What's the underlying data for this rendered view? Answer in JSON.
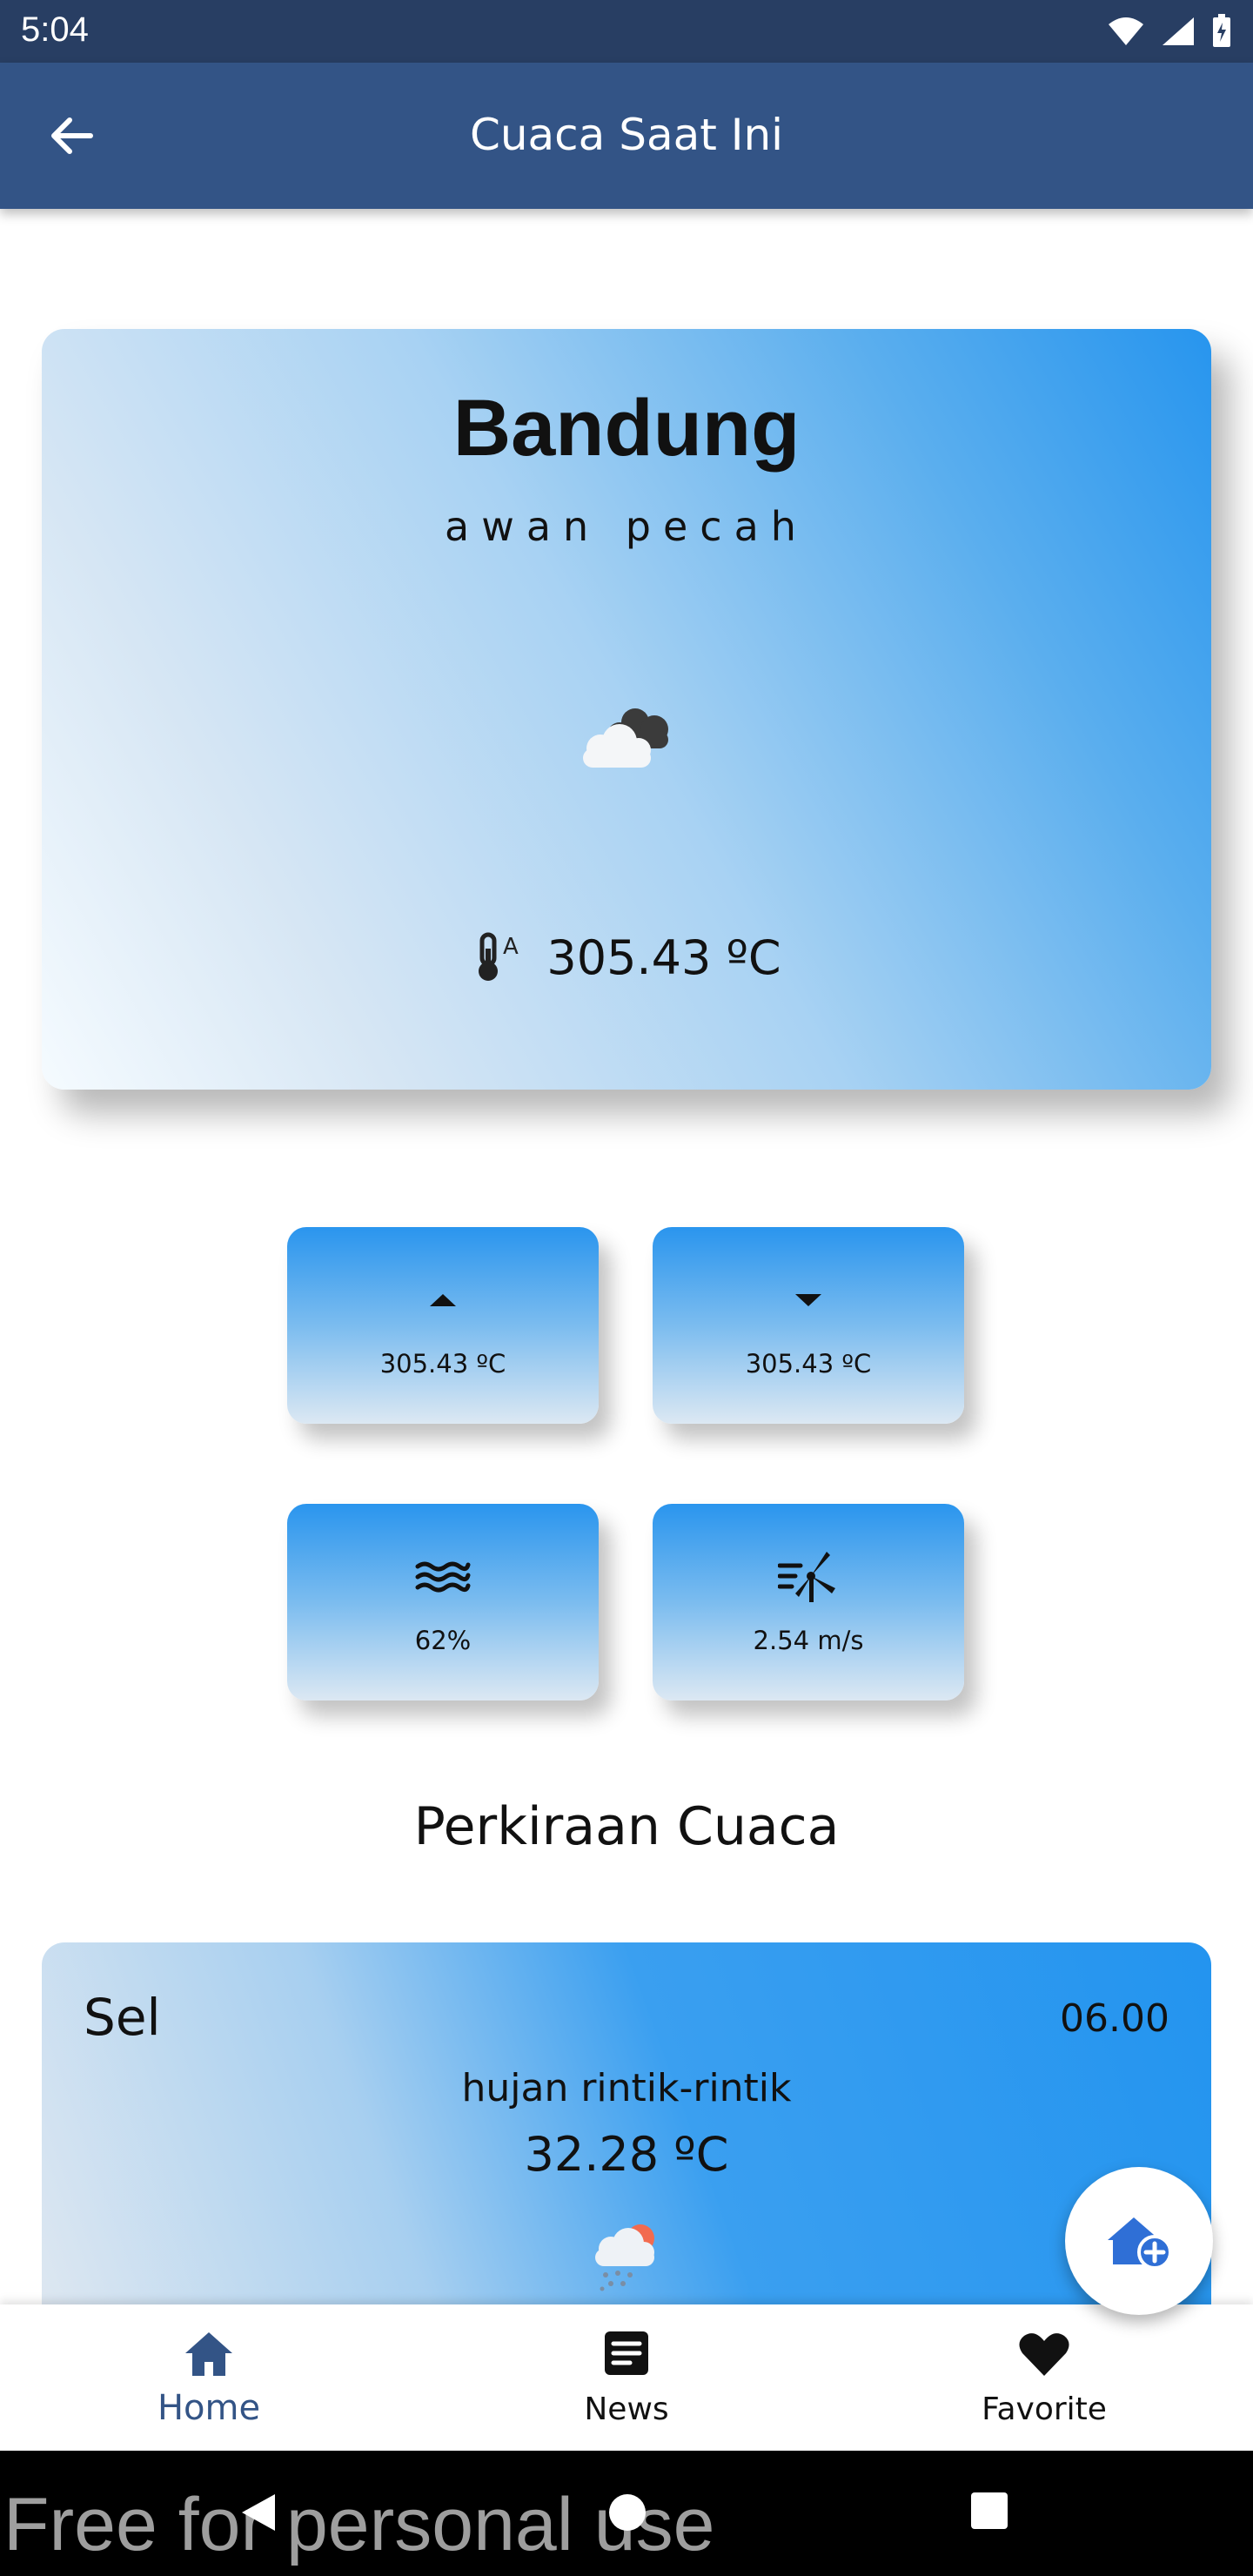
{
  "status_bar": {
    "time": "5:04"
  },
  "app_bar": {
    "title": "Cuaca Saat Ini"
  },
  "current": {
    "city": "Bandung",
    "description": "awan pecah",
    "temperature": "305.43 ºC"
  },
  "stats": {
    "temp_max": "305.43 ºC",
    "temp_min": "305.43 ºC",
    "humidity": "62%",
    "wind_speed": "2.54 m/s"
  },
  "forecast": {
    "section_title": "Perkiraan Cuaca",
    "items": [
      {
        "day": "Sel",
        "time": "06.00",
        "description": "hujan rintik-rintik",
        "temperature": "32.28 ºC"
      }
    ]
  },
  "bottom_nav": {
    "items": [
      {
        "label": "Home",
        "active": true
      },
      {
        "label": "News",
        "active": false
      },
      {
        "label": "Favorite",
        "active": false
      }
    ]
  },
  "watermark": "Free for personal use",
  "colors": {
    "app_bar": "#335486",
    "status_bar": "#283e63",
    "accent": "#2394ef",
    "nav_active": "#335486"
  }
}
